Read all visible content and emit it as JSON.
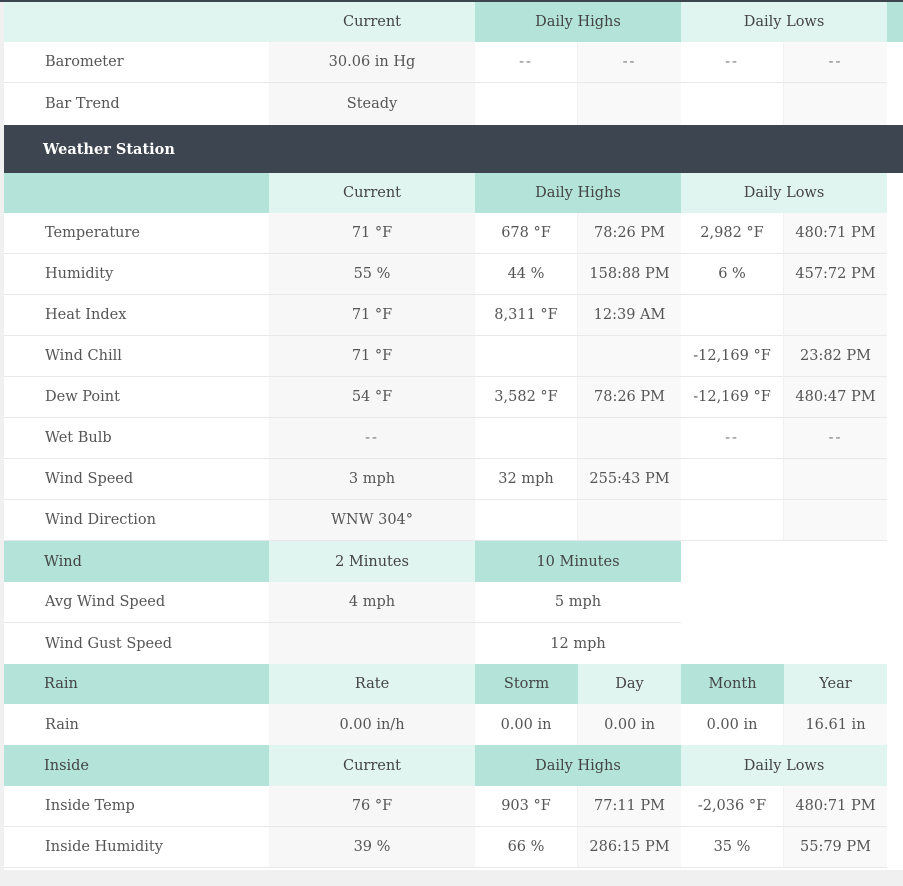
{
  "console": {
    "header": {
      "current": "Current",
      "daily_highs": "Daily Highs",
      "daily_lows": "Daily Lows"
    },
    "rows": [
      {
        "label": "Barometer",
        "current": "30.06 in Hg",
        "high": "--",
        "high_time": "--",
        "low": "--",
        "low_time": "--"
      },
      {
        "label": "Bar Trend",
        "current": "Steady",
        "high": "",
        "high_time": "",
        "low": "",
        "low_time": ""
      }
    ]
  },
  "station": {
    "title": "Weather Station",
    "header": {
      "current": "Current",
      "daily_highs": "Daily Highs",
      "daily_lows": "Daily Lows"
    },
    "rows": [
      {
        "label": "Temperature",
        "current": "71 °F",
        "high": "678 °F",
        "high_time": "78:26 PM",
        "low": "2,982 °F",
        "low_time": "480:71 PM"
      },
      {
        "label": "Humidity",
        "current": "55 %",
        "high": "44 %",
        "high_time": "158:88 PM",
        "low": "6 %",
        "low_time": "457:72 PM"
      },
      {
        "label": "Heat Index",
        "current": "71 °F",
        "high": "8,311 °F",
        "high_time": "12:39 AM",
        "low": "",
        "low_time": ""
      },
      {
        "label": "Wind Chill",
        "current": "71 °F",
        "high": "",
        "high_time": "",
        "low": "-12,169 °F",
        "low_time": "23:82 PM"
      },
      {
        "label": "Dew Point",
        "current": "54 °F",
        "high": "3,582 °F",
        "high_time": "78:26 PM",
        "low": "-12,169 °F",
        "low_time": "480:47 PM"
      },
      {
        "label": "Wet Bulb",
        "current": "--",
        "high": "",
        "high_time": "",
        "low": "--",
        "low_time": "--"
      },
      {
        "label": "Wind Speed",
        "current": "3 mph",
        "high": "32 mph",
        "high_time": "255:43 PM",
        "low": "",
        "low_time": ""
      },
      {
        "label": "Wind Direction",
        "current": "WNW 304°",
        "high": "",
        "high_time": "",
        "low": "",
        "low_time": ""
      }
    ]
  },
  "wind": {
    "header": {
      "label": "Wind",
      "two_min": "2 Minutes",
      "ten_min": "10 Minutes"
    },
    "rows": [
      {
        "label": "Avg Wind Speed",
        "two_min": "4 mph",
        "ten_min": "5 mph"
      },
      {
        "label": "Wind Gust Speed",
        "two_min": "",
        "ten_min": "12 mph"
      }
    ]
  },
  "rain": {
    "header": {
      "label": "Rain",
      "rate": "Rate",
      "storm": "Storm",
      "day": "Day",
      "month": "Month",
      "year": "Year"
    },
    "row": {
      "label": "Rain",
      "rate": "0.00 in/h",
      "storm": "0.00 in",
      "day": "0.00 in",
      "month": "0.00 in",
      "year": "16.61 in"
    }
  },
  "inside": {
    "header": {
      "label": "Inside",
      "current": "Current",
      "daily_highs": "Daily Highs",
      "daily_lows": "Daily Lows"
    },
    "rows": [
      {
        "label": "Inside Temp",
        "current": "76 °F",
        "high": "903 °F",
        "high_time": "77:11 PM",
        "low": "-2,036 °F",
        "low_time": "480:71 PM"
      },
      {
        "label": "Inside Humidity",
        "current": "39 %",
        "high": "66 %",
        "high_time": "286:15 PM",
        "low": "35 %",
        "low_time": "55:79 PM"
      }
    ]
  },
  "colors": {
    "header_dark": "#b3e3d9",
    "header_light": "#e1f5f0",
    "station_bar": "#3d4650"
  }
}
